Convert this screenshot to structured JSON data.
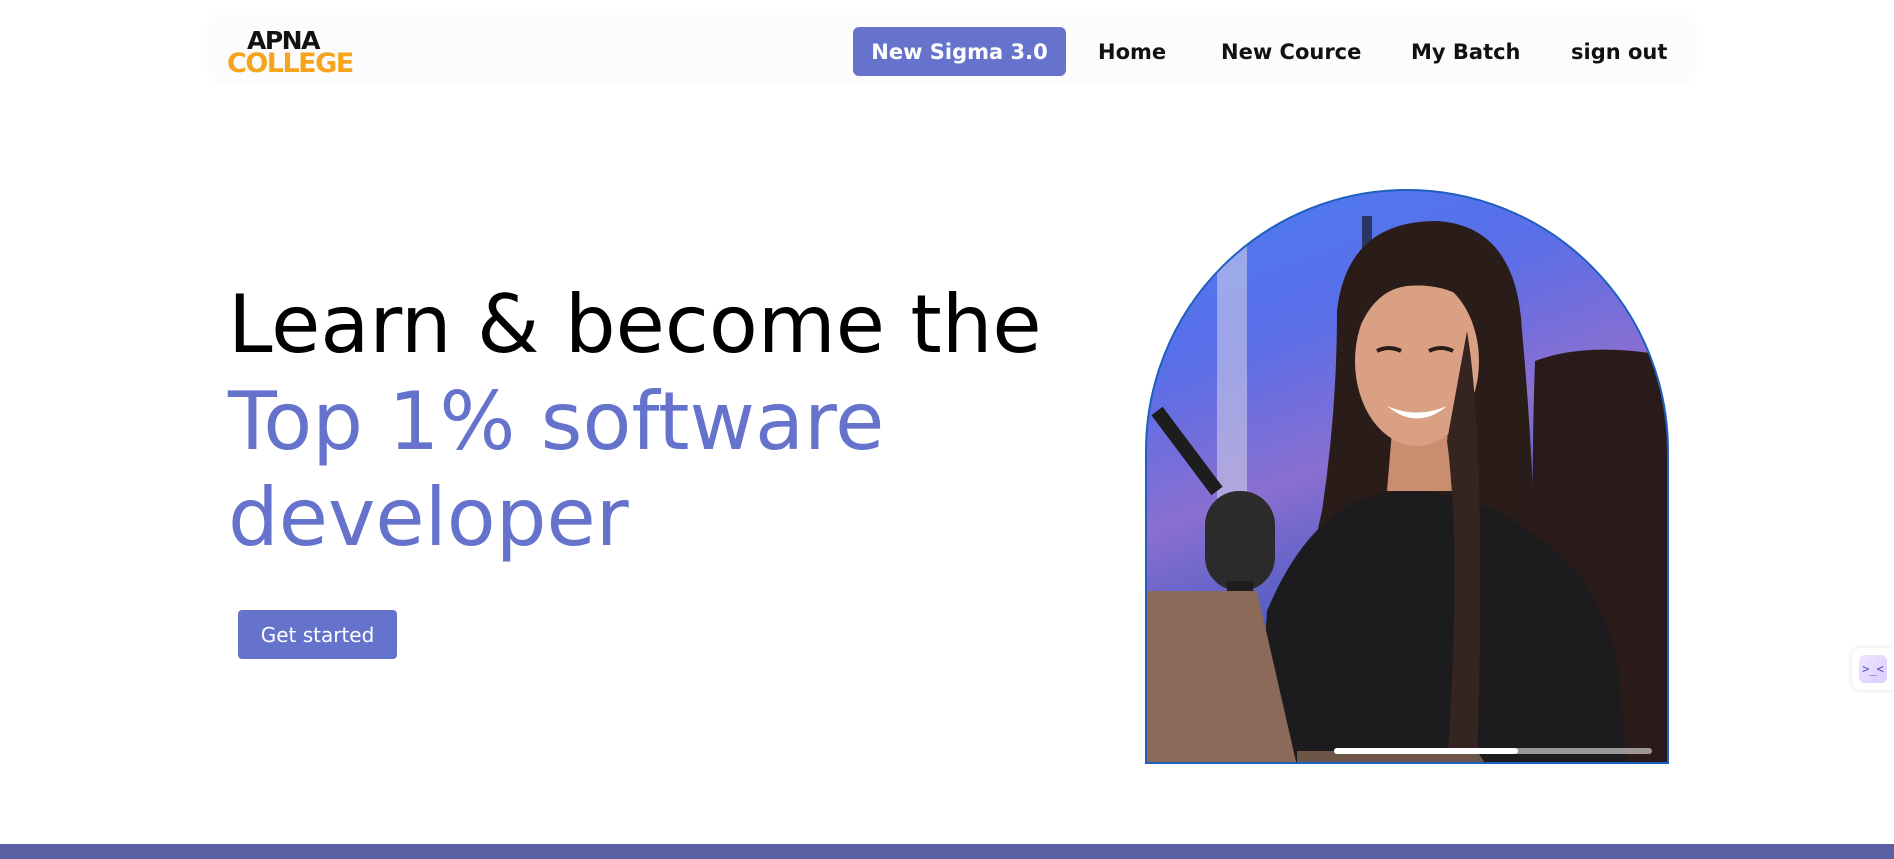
{
  "logo": {
    "line1": "APNA",
    "line2": "COLLEGE"
  },
  "nav": {
    "cta": "New Sigma 3.0",
    "home": "Home",
    "course": "New Cource",
    "batch": "My Batch",
    "signout": "sign out"
  },
  "hero": {
    "line1": "Learn & become the",
    "line2": "Top 1% software",
    "line3": "developer",
    "button": "Get started"
  },
  "video": {
    "progress": 0.58
  },
  "side_widget": {
    "glyph": ">_<"
  },
  "colors": {
    "accent": "#6673cc",
    "logo_orange": "#f7a41d",
    "footer_bar": "#5b5fa3"
  }
}
